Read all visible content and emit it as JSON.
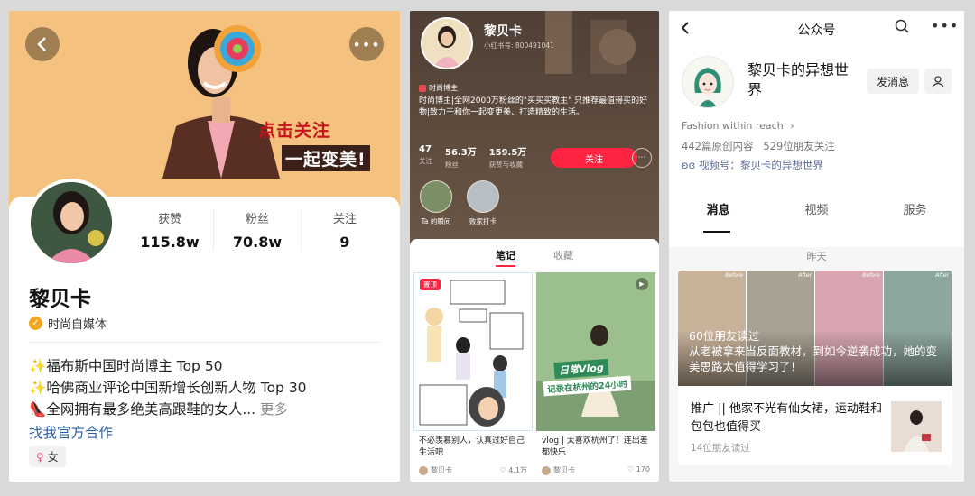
{
  "douyin": {
    "sticker_line1": "点击关注",
    "sticker_line2": "一起变美!",
    "stats": [
      {
        "label": "获赞",
        "value": "115.8w"
      },
      {
        "label": "粉丝",
        "value": "70.8w"
      },
      {
        "label": "关注",
        "value": "9"
      }
    ],
    "name": "黎贝卡",
    "verified": "时尚自媒体",
    "bio": [
      "福布斯中国时尚博主 Top 50",
      "哈佛商业评论中国新增长创新人物 Top 30",
      "全网拥有最多绝美高跟鞋的女人..."
    ],
    "bio_more": "更多",
    "coop_link": "找我官方合作",
    "gender": "女"
  },
  "xhs": {
    "name": "黎贝卡",
    "red_id": "小红书号: 800491041",
    "tag": "时尚博主",
    "intro": "时尚博主|全网2000万粉丝的\"买买买教主\" 只推荐最值得买的好物|致力于和你一起变更美、打造精致的生活。",
    "stats": [
      {
        "value": "47",
        "label": "关注"
      },
      {
        "value": "56.3万",
        "label": "粉丝"
      },
      {
        "value": "159.5万",
        "label": "获赞与收藏"
      }
    ],
    "follow_label": "关注",
    "highlights": [
      {
        "label": "Ta 的瞬间"
      },
      {
        "label": "败家打卡"
      }
    ],
    "tabs": [
      "笔记",
      "收藏"
    ],
    "notes": [
      {
        "badge": "置顶",
        "caption": "不必羡慕别人，认真过好自己生活吧",
        "author": "黎贝卡",
        "likes": "4.1万"
      },
      {
        "overlay_title": "日常Vlog",
        "overlay_sub": "记录在杭州的24小时",
        "caption": "vlog | 太喜欢杭州了！连出差都快乐",
        "author": "黎贝卡",
        "likes": "170"
      }
    ]
  },
  "wechat": {
    "title": "公众号",
    "name": "黎贝卡的异想世界",
    "send_msg": "发消息",
    "signature": "Fashion within reach",
    "counts": "442篇原创内容   529位朋友关注",
    "video_link": "视频号：黎贝卡的异想世界",
    "tabs": [
      "消息",
      "视频",
      "服务"
    ],
    "day_label": "昨天",
    "article": {
      "cover_labels": [
        "Before",
        "After",
        "Before",
        "After"
      ],
      "headline": "60位朋友读过\n从老被拿来当反面教材，到如今逆袭成功，她的变美思路太值得学习了！",
      "ad_title": "推广 || 他家不光有仙女裙，运动鞋和包包也值得买",
      "reads": "14位朋友读过"
    }
  }
}
